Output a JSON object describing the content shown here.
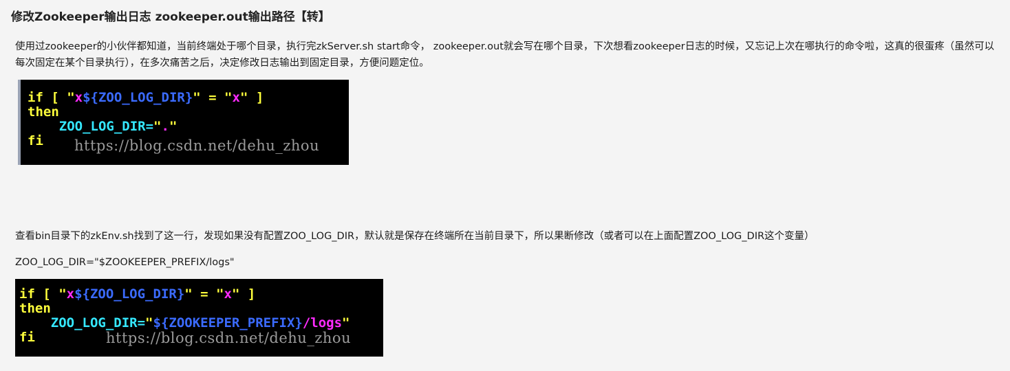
{
  "article": {
    "title": "修改Zookeeper输出日志 zookeeper.out输出路径【转】",
    "paragraph1": "使用过zookeeper的小伙伴都知道，当前终端处于哪个目录，执行完zkServer.sh start命令， zookeeper.out就会写在哪个目录，下次想看zookeeper日志的时候，又忘记上次在哪执行的命令啦，这真的很蛋疼（虽然可以每次固定在某个目录执行），在多次痛苦之后，决定修改日志输出到固定目录，方便问题定位。",
    "paragraph2": "查看bin目录下的zkEnv.sh找到了这一行，发现如果没有配置ZOO_LOG_DIR，默认就是保存在终端所在当前目录下，所以果断修改（或者可以在上面配置ZOO_LOG_DIR这个变量）",
    "paragraph3": "ZOO_LOG_DIR=\"$ZOOKEEPER_PREFIX/logs\""
  },
  "code_image_1": {
    "if_kw": "if [ ",
    "q1": "\"",
    "x1": "x",
    "var": "${ZOO_LOG_DIR}",
    "q2": "\" = ",
    "q3": "\"",
    "x2": "x",
    "q4": "\" ]",
    "then_kw": "then",
    "indent": "    ",
    "assign": "ZOO_LOG_DIR=",
    "q5": "\"",
    "dot": ".",
    "q6": "\"",
    "fi_kw": "fi",
    "watermark": "https://blog.csdn.net/dehu_zhou"
  },
  "code_image_2": {
    "if_kw": "if [ ",
    "q1": "\"",
    "x1": "x",
    "var": "${ZOO_LOG_DIR}",
    "q2": "\" = ",
    "q3": "\"",
    "x2": "x",
    "q4": "\" ]",
    "then_kw": "then",
    "indent": "    ",
    "assign": "ZOO_LOG_DIR=",
    "q5": "\"",
    "prefix_var": "${ZOOKEEPER_PREFIX}",
    "path": "/logs",
    "q6": "\"",
    "fi_kw": "fi",
    "watermark": "https://blog.csdn.net/dehu_zhou"
  },
  "colors": {
    "background": "#f4f4f4",
    "keyword": "#ffff3c",
    "string": "#ff2bff",
    "variable": "#3b6bff",
    "identifier": "#35e8ff",
    "watermark": "#9b9b9b"
  }
}
